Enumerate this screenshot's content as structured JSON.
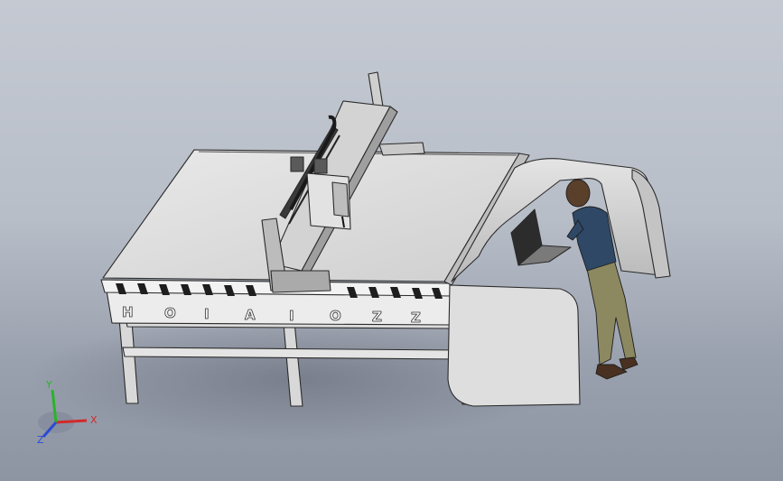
{
  "viewport": {
    "background_top": "#c4c9d2",
    "background_bottom": "#8d94a2"
  },
  "machine": {
    "side_letters": [
      "H",
      "O",
      "I",
      "A",
      "I",
      "O",
      "Z",
      "Z"
    ],
    "frame_color": "#e6e6e6",
    "edge_color": "#2a2a2a",
    "bed_color": "#dadada"
  },
  "operator": {
    "shirt_color": "#2f4866",
    "pants_color": "#8c8860",
    "skin_color": "#5a3f2a"
  },
  "triad": {
    "x_label": "X",
    "y_label": "Y",
    "z_label": "Z",
    "x_color": "#d22a2a",
    "y_color": "#28b428",
    "z_color": "#2a4ad2"
  }
}
